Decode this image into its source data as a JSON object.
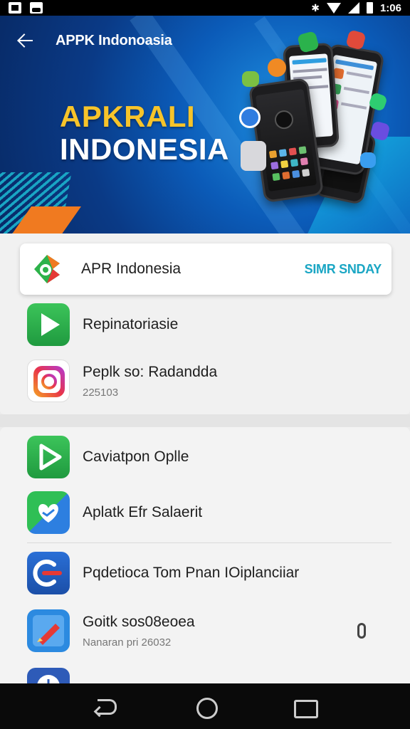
{
  "status_bar": {
    "time": "1:06"
  },
  "header": {
    "title": "APPK Indonoasia",
    "hero_line1": "APKRALI",
    "hero_line2": "INDONESIA"
  },
  "featured": {
    "title": "APR Indonesia",
    "action_label": "SIMR SNDAY",
    "icon": "apr-logo-icon"
  },
  "group1": [
    {
      "title": "Repinatoriasie",
      "subtitle": "",
      "icon": "play-green-icon"
    },
    {
      "title": "Peplk so: Radandda",
      "subtitle": "225103",
      "icon": "camera-instagram-icon"
    }
  ],
  "group2": [
    {
      "title": "Caviatpon Oplle",
      "subtitle": "",
      "icon": "play-outline-icon"
    },
    {
      "title": "Aplatk Efr Salaerit",
      "subtitle": "",
      "icon": "heart-shield-icon"
    },
    {
      "title": "Pqdetioca Tom Pnan IOiplanciiar",
      "subtitle": "",
      "icon": "logout-circle-icon"
    },
    {
      "title": "Goitk sos08eoea",
      "subtitle": "Nanaran pri 26032",
      "icon": "pencil-canvas-icon"
    }
  ],
  "colors": {
    "accent": "#1aa6c4",
    "banner_blue": "#0b5bb8",
    "hero_yellow": "#f7c42a"
  }
}
